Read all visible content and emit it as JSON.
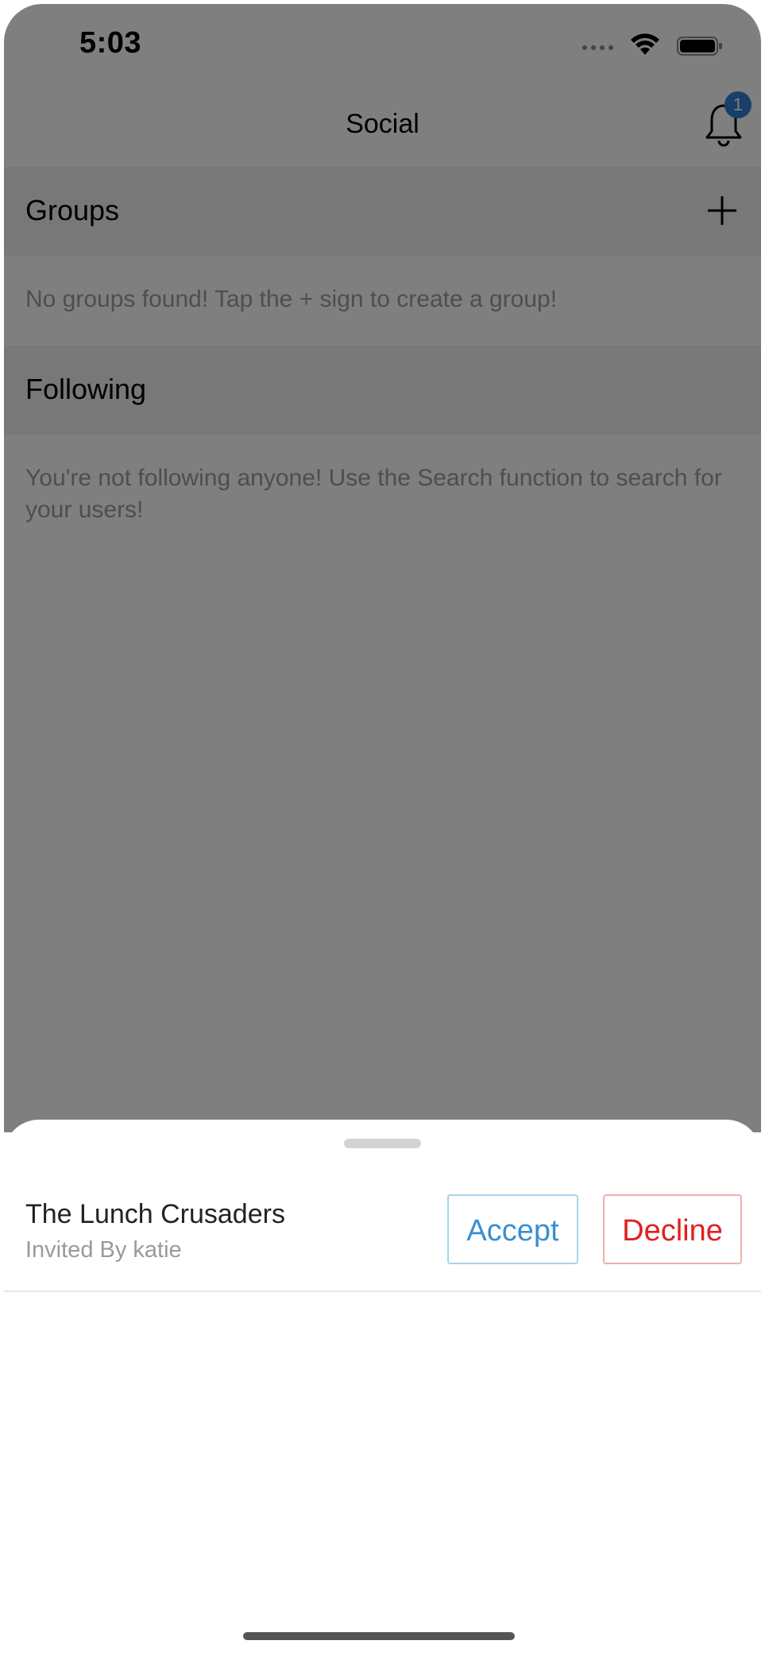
{
  "status_bar": {
    "time": "5:03"
  },
  "nav": {
    "title": "Social",
    "notification_count": "1"
  },
  "groups": {
    "header": "Groups",
    "empty_message": "No groups found! Tap the + sign to create a group!"
  },
  "following": {
    "header": "Following",
    "empty_message": "You're not following anyone! Use the Search function to search for your users!"
  },
  "invite": {
    "group_name": "The Lunch Crusaders",
    "invited_by": "Invited By katie",
    "accept_label": "Accept",
    "decline_label": "Decline"
  },
  "colors": {
    "accent_blue": "#3a8fd0",
    "decline_red": "#e02020",
    "badge_blue": "#2f7fd0",
    "overlay": "rgba(0,0,0,0.5)"
  },
  "icons": {
    "bell": "bell-icon",
    "add": "plus-icon",
    "wifi": "wifi-icon",
    "battery": "battery-icon",
    "signal": "signal-icon"
  }
}
